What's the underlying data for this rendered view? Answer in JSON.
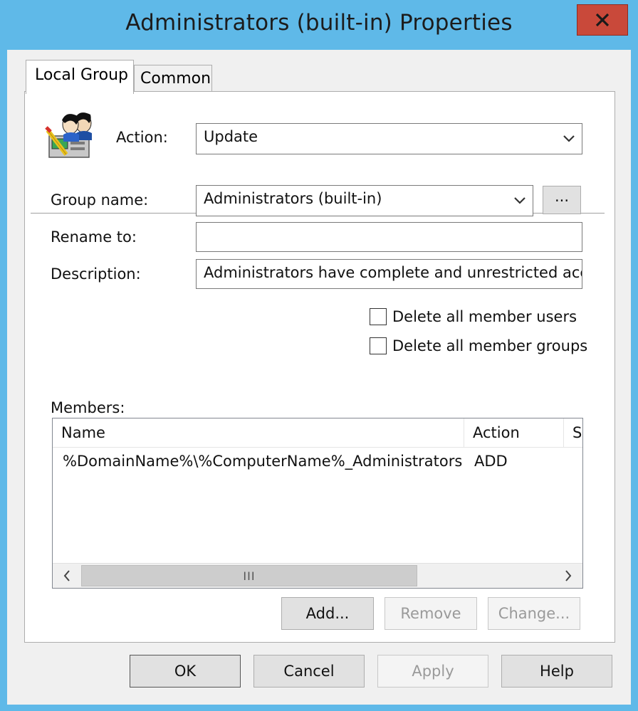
{
  "window": {
    "title": "Administrators (built-in) Properties",
    "close_glyph": "X"
  },
  "tabs": [
    {
      "label": "Local Group",
      "selected": true
    },
    {
      "label": "Common",
      "selected": false
    }
  ],
  "form": {
    "action_label": "Action:",
    "action_value": "Update",
    "group_name_label": "Group name:",
    "group_name_value": "Administrators (built-in)",
    "browse_label": "...",
    "rename_label": "Rename to:",
    "rename_value": "",
    "description_label": "Description:",
    "description_value": "Administrators have complete and unrestricted acc",
    "delete_users_label": "Delete all member users",
    "delete_users_checked": false,
    "delete_groups_label": "Delete all member groups",
    "delete_groups_checked": false
  },
  "members": {
    "label": "Members:",
    "columns": [
      "Name",
      "Action",
      "S"
    ],
    "rows": [
      {
        "name": "%DomainName%\\%ComputerName%_Administrators",
        "action": "ADD"
      }
    ],
    "scroll_thumb_glyph": "III",
    "add_label": "Add...",
    "remove_label": "Remove",
    "change_label": "Change..."
  },
  "buttons": {
    "ok": "OK",
    "cancel": "Cancel",
    "apply": "Apply",
    "help": "Help"
  },
  "colors": {
    "frame": "#5fb9e8",
    "close_button": "#c9493a"
  }
}
